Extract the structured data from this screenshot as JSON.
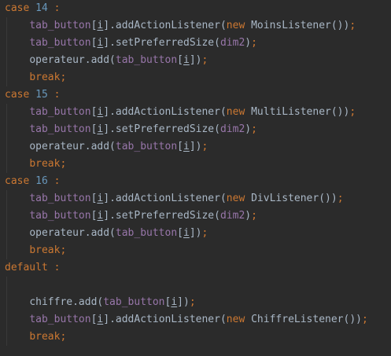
{
  "editor": {
    "language": "Java",
    "colors": {
      "background": "#2b2b2b",
      "default": "#a9b7c6",
      "keyword": "#cc7832",
      "number": "#6897bb",
      "field": "#9876aa",
      "indent_guide": "#393939"
    },
    "lines": [
      [
        {
          "t": "case ",
          "c": "kw"
        },
        {
          "t": "14",
          "c": "num"
        },
        {
          "t": " :",
          "c": "kw"
        }
      ],
      [
        {
          "t": "    "
        },
        {
          "t": "tab_button",
          "c": "field"
        },
        {
          "t": "["
        },
        {
          "t": "i",
          "c": "ul"
        },
        {
          "t": "].addActionListener("
        },
        {
          "t": "new ",
          "c": "kw"
        },
        {
          "t": "MoinsListener())"
        },
        {
          "t": ";",
          "c": "kw"
        }
      ],
      [
        {
          "t": "    "
        },
        {
          "t": "tab_button",
          "c": "field"
        },
        {
          "t": "["
        },
        {
          "t": "i",
          "c": "ul"
        },
        {
          "t": "].setPreferredSize("
        },
        {
          "t": "dim2",
          "c": "field"
        },
        {
          "t": ")"
        },
        {
          "t": ";",
          "c": "kw"
        }
      ],
      [
        {
          "t": "    "
        },
        {
          "t": "operateur.add("
        },
        {
          "t": "tab_button",
          "c": "field"
        },
        {
          "t": "["
        },
        {
          "t": "i",
          "c": "ul"
        },
        {
          "t": "])"
        },
        {
          "t": ";",
          "c": "kw"
        }
      ],
      [
        {
          "t": "    "
        },
        {
          "t": "break;",
          "c": "kw"
        }
      ],
      [
        {
          "t": "case ",
          "c": "kw"
        },
        {
          "t": "15",
          "c": "num"
        },
        {
          "t": " :",
          "c": "kw"
        }
      ],
      [
        {
          "t": "    "
        },
        {
          "t": "tab_button",
          "c": "field"
        },
        {
          "t": "["
        },
        {
          "t": "i",
          "c": "ul"
        },
        {
          "t": "].addActionListener("
        },
        {
          "t": "new ",
          "c": "kw"
        },
        {
          "t": "MultiListener())"
        },
        {
          "t": ";",
          "c": "kw"
        }
      ],
      [
        {
          "t": "    "
        },
        {
          "t": "tab_button",
          "c": "field"
        },
        {
          "t": "["
        },
        {
          "t": "i",
          "c": "ul"
        },
        {
          "t": "].setPreferredSize("
        },
        {
          "t": "dim2",
          "c": "field"
        },
        {
          "t": ")"
        },
        {
          "t": ";",
          "c": "kw"
        }
      ],
      [
        {
          "t": "    "
        },
        {
          "t": "operateur.add("
        },
        {
          "t": "tab_button",
          "c": "field"
        },
        {
          "t": "["
        },
        {
          "t": "i",
          "c": "ul"
        },
        {
          "t": "])"
        },
        {
          "t": ";",
          "c": "kw"
        }
      ],
      [
        {
          "t": "    "
        },
        {
          "t": "break;",
          "c": "kw"
        }
      ],
      [
        {
          "t": "case ",
          "c": "kw"
        },
        {
          "t": "16",
          "c": "num"
        },
        {
          "t": " :",
          "c": "kw"
        }
      ],
      [
        {
          "t": "    "
        },
        {
          "t": "tab_button",
          "c": "field"
        },
        {
          "t": "["
        },
        {
          "t": "i",
          "c": "ul"
        },
        {
          "t": "].addActionListener("
        },
        {
          "t": "new ",
          "c": "kw"
        },
        {
          "t": "DivListener())"
        },
        {
          "t": ";",
          "c": "kw"
        }
      ],
      [
        {
          "t": "    "
        },
        {
          "t": "tab_button",
          "c": "field"
        },
        {
          "t": "["
        },
        {
          "t": "i",
          "c": "ul"
        },
        {
          "t": "].setPreferredSize("
        },
        {
          "t": "dim2",
          "c": "field"
        },
        {
          "t": ")"
        },
        {
          "t": ";",
          "c": "kw"
        }
      ],
      [
        {
          "t": "    "
        },
        {
          "t": "operateur.add("
        },
        {
          "t": "tab_button",
          "c": "field"
        },
        {
          "t": "["
        },
        {
          "t": "i",
          "c": "ul"
        },
        {
          "t": "])"
        },
        {
          "t": ";",
          "c": "kw"
        }
      ],
      [
        {
          "t": "    "
        },
        {
          "t": "break;",
          "c": "kw"
        }
      ],
      [
        {
          "t": "default ",
          "c": "kw"
        },
        {
          "t": ":",
          "c": "kw"
        }
      ],
      [],
      [
        {
          "t": "    "
        },
        {
          "t": "chiffre.add("
        },
        {
          "t": "tab_button",
          "c": "field"
        },
        {
          "t": "["
        },
        {
          "t": "i",
          "c": "ul"
        },
        {
          "t": "])"
        },
        {
          "t": ";",
          "c": "kw"
        }
      ],
      [
        {
          "t": "    "
        },
        {
          "t": "tab_button",
          "c": "field"
        },
        {
          "t": "["
        },
        {
          "t": "i",
          "c": "ul"
        },
        {
          "t": "].addActionListener("
        },
        {
          "t": "new ",
          "c": "kw"
        },
        {
          "t": "ChiffreListener())"
        },
        {
          "t": ";",
          "c": "kw"
        }
      ],
      [
        {
          "t": "    "
        },
        {
          "t": "break;",
          "c": "kw"
        }
      ]
    ]
  }
}
